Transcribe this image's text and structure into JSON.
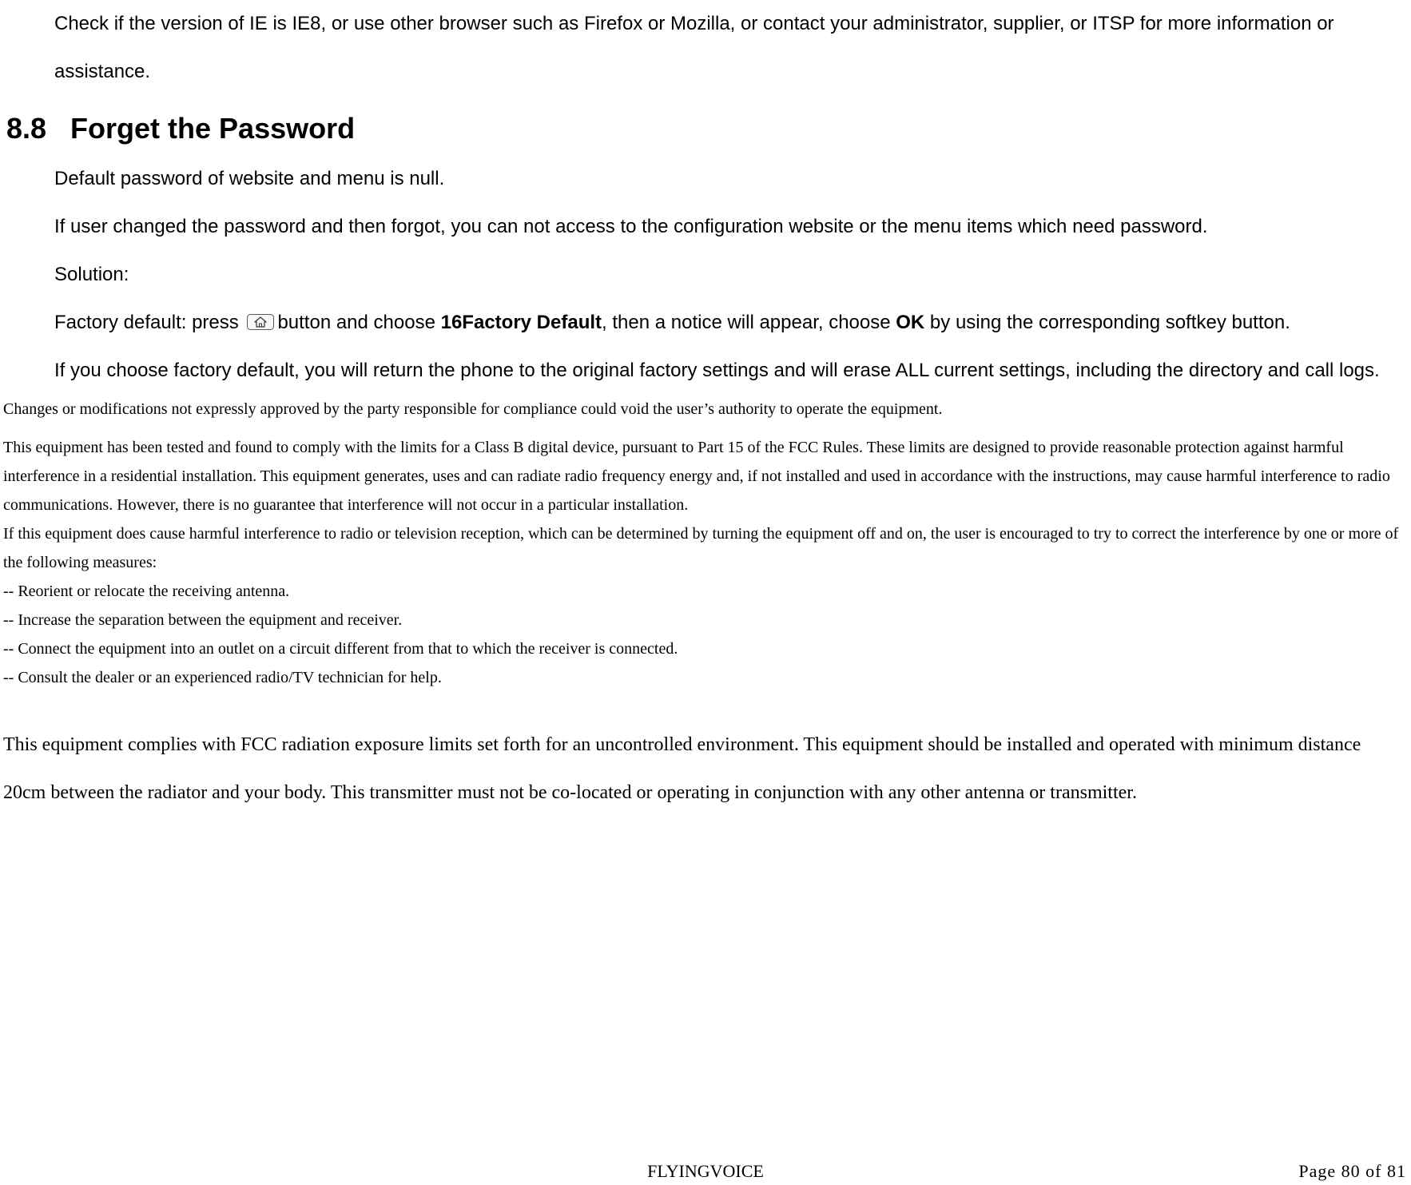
{
  "top_para": "Check if the version of IE is IE8, or use other browser such as Firefox or Mozilla, or contact your administrator, supplier, or ITSP for more information or assistance.",
  "heading": {
    "number": "8.8",
    "title": "Forget the Password"
  },
  "p_default": "Default password of website and menu is null.",
  "p_changed": "If user changed the password and then forgot, you can not access to the configuration website or the menu items which need password.",
  "p_solution_label": "Solution:",
  "factory": {
    "pre": "Factory default: press ",
    "post1": "button and choose ",
    "bold1": "16Factory Default",
    "mid": ", then a notice will appear, choose ",
    "bold2": "OK",
    "post2": " by using the corresponding softkey button."
  },
  "p_warn": "If you choose factory default, you will return the phone to the original factory settings and will erase ALL current settings, including the directory and call logs.",
  "compliance": {
    "l1": "Changes or modifications not expressly approved by the party responsible for compliance could void the user’s authority to operate the equipment.",
    "l2a": "This equipment has been tested and found to comply with the limits for a Class B digital device, pursuant to Part 15 of the FCC Rules. These limits are designed to provide reasonable protection against harmful interference in a residential installation. This equipment generates, uses and can radiate radio frequency energy and, if not installed and used in accordance with the instructions, may cause harmful interference to radio communications. However, there is no guarantee that interference will not occur in a particular installation.",
    "l2b": "If this equipment does cause harmful interference to radio or television reception, which can be determined by turning the equipment off and on, the user is encouraged to try to correct the interference by one or more of the following measures:",
    "m1": "-- Reorient or relocate the receiving antenna.",
    "m2": "-- Increase the separation between the equipment and receiver.",
    "m3": "-- Connect the equipment into an outlet on a circuit different from that to which the receiver is connected.",
    "m4": "-- Consult the dealer or an experienced radio/TV technician for help."
  },
  "exposure": "This equipment complies with FCC radiation exposure limits set forth for an uncontrolled environment. This equipment should be installed and operated with minimum distance 20cm between the radiator and your body. This transmitter must not be co-located or operating in conjunction with any other antenna or transmitter.",
  "footer": {
    "center": "FLYINGVOICE",
    "page": "Page 80 of 81"
  }
}
